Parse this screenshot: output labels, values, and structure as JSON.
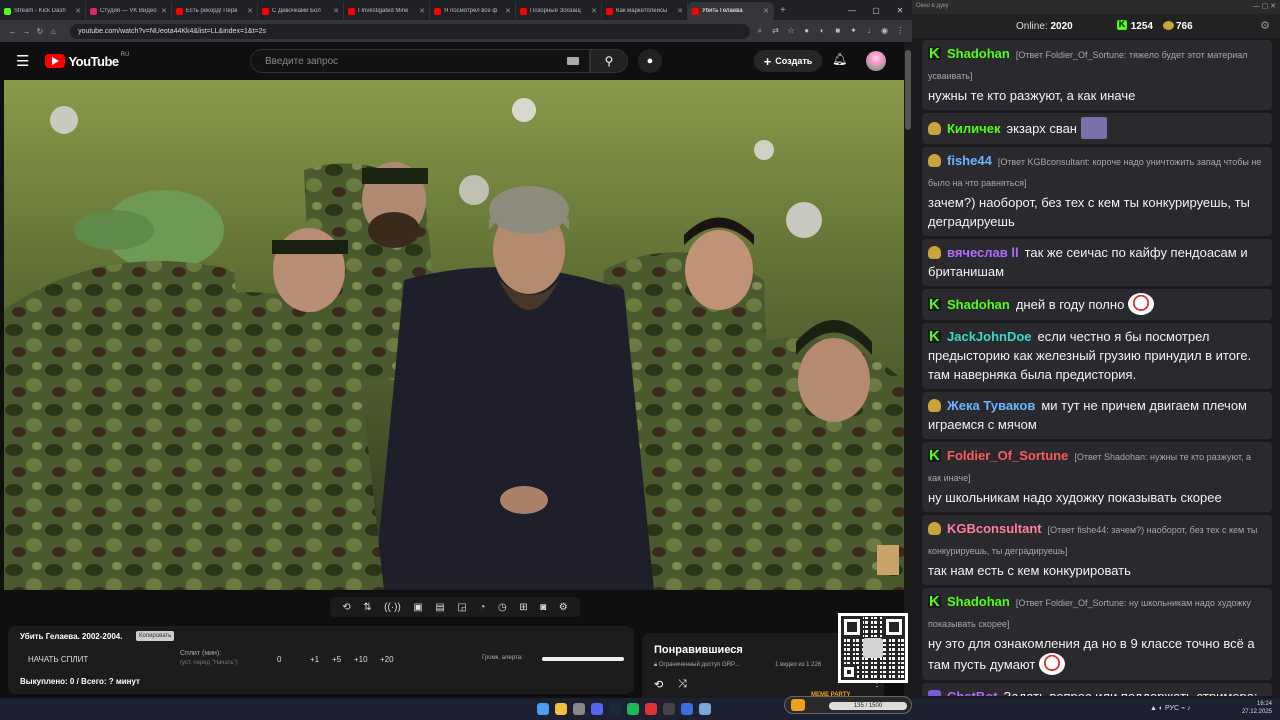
{
  "browser": {
    "tabs": [
      {
        "label": "Stream - Kick Dash",
        "color": "#53fc18"
      },
      {
        "label": "Студия — VK Видео",
        "color": "#e4235f"
      },
      {
        "label": "Есть рекорд! Перв",
        "color": "#ff0000"
      },
      {
        "label": "С Девочками Бол",
        "color": "#ff0000"
      },
      {
        "label": "I Investigated Mine",
        "color": "#ff0000"
      },
      {
        "label": "Я посмотрел все ф",
        "color": "#ff0000"
      },
      {
        "label": "Позорные Зоозащ",
        "color": "#ff0000"
      },
      {
        "label": "Как маркетплейсы",
        "color": "#ff0000"
      },
      {
        "label": "Убить Гелаева",
        "color": "#ff0000",
        "active": true
      }
    ],
    "url": "youtube.com/watch?v=NUeota44Kk4&list=LL&index=1&t=2s"
  },
  "youtube": {
    "logo": "YouTube",
    "region": "RU",
    "search_placeholder": "Введите запрос",
    "create_label": "Создать",
    "video": {
      "title": "Убить Гелаева. 2002-2004.",
      "copy_label": "Копировать"
    },
    "toolbar_icons": [
      "loop-icon",
      "sort-icon",
      "broadcast-icon",
      "screenshot-icon",
      "film-icon",
      "pip-icon",
      "timer-icon",
      "speed-icon",
      "add-icon",
      "camera-icon",
      "settings-icon"
    ],
    "split": {
      "start_label": "НАЧАТЬ СПЛИТ",
      "split_label": "Сплит (мин):",
      "split_sub": "(уст. перед \"Начать\")",
      "current": "0",
      "increments": [
        "+1",
        "+5",
        "+10",
        "+20"
      ],
      "alert_label": "Громк. алерта:",
      "alert_level": 1.0,
      "footer": "Выкуплено: 0 / Всего: ? минут"
    },
    "liked": {
      "title": "Понравившиеся",
      "sub": "Ограниченный доступ GRP...",
      "count": "1 видео из 1 226"
    }
  },
  "chat": {
    "window_title": "Окно в дуку",
    "online_label": "Online:",
    "online_value": "2020",
    "kick_count": "1254",
    "coin_count": "766",
    "messages": [
      {
        "badge": "k",
        "nick": "Shadohan",
        "color": "#53fc18",
        "reply": "[Ответ Foldier_Of_Sortune: тяжело будет этот материал усваивать]",
        "text": "нужны те кто разжуют, а как иначе"
      },
      {
        "badge": "e",
        "nick": "Киличек",
        "color": "#53fc18",
        "reply": "",
        "text": "экзарх сван",
        "emote": "pic"
      },
      {
        "badge": "e",
        "nick": "fishe44",
        "color": "#6ab3ff",
        "reply": "[Ответ KGBconsultant: короче надо уничтожить запад чтобы не было на что равняться]",
        "text": "зачем?) наоборот, без тех с кем ты конкурируешь, ты деградируешь"
      },
      {
        "badge": "e",
        "nick": "вячеслав ll",
        "color": "#b36bff",
        "reply": "",
        "text": "так же сеичас по кайфу пендоасам и британишам"
      },
      {
        "badge": "k",
        "nick": "Shadohan",
        "color": "#53fc18",
        "reply": "",
        "text": "дней в году полно",
        "emote": "face"
      },
      {
        "badge": "k",
        "nick": "JackJohnDoe",
        "color": "#3ad9c9",
        "reply": "",
        "text": "если честно я бы посмотрел предысторию как железный грузию принудил в итоге. там наверняка была предистория."
      },
      {
        "badge": "e",
        "nick": "Жека Туваков",
        "color": "#6ab3ff",
        "reply": "",
        "text": "ми тут не причем двигаем плечом играемся с мячом"
      },
      {
        "badge": "k",
        "nick": "Foldier_Of_Sortune",
        "color": "#ff5a5a",
        "reply": "[Ответ Shadohan: нужны те кто разжуют, а как иначе]",
        "text": "ну школьникам надо художку показывать скорее"
      },
      {
        "badge": "e",
        "nick": "KGBconsultant",
        "color": "#ff7fa0",
        "reply": "[Ответ fishe44: зачем?) наоборот, без тех с кем ты конкурируешь, ты деградируешь]",
        "text": "так нам есть с кем конкурировать"
      },
      {
        "badge": "k",
        "nick": "Shadohan",
        "color": "#53fc18",
        "reply": "[Ответ Foldier_Of_Sortune: ну школьникам надо художку показывать скорее]",
        "text": "ну это для ознакомления да но в 9 классе точно всё а там пусть думают",
        "emote": "face"
      },
      {
        "badge": "d",
        "nick": "ChatBot",
        "color": "#b36bff",
        "reply": "",
        "text": "Задать вопрос или поддержать стримера:",
        "link": "https://new.donatepay.ru/@GRPZDC"
      }
    ]
  },
  "overlay": {
    "meme_label": "MEME PARTY",
    "meme_progress": "135 / 1500"
  },
  "taskbar": {
    "lang": "РУС",
    "time": "16:24",
    "date": "27.12.2025"
  }
}
